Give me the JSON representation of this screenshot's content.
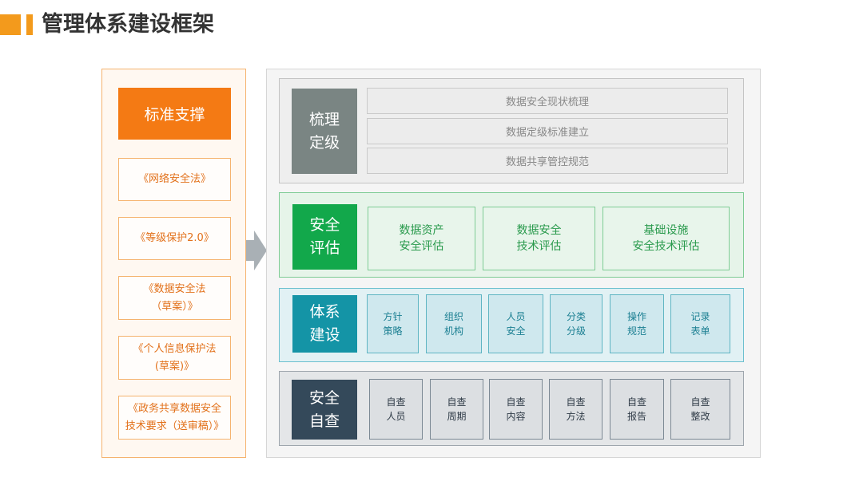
{
  "title": "管理体系建设框架",
  "colors": {
    "accent_orange": "#f47a14",
    "green": "#12a84b",
    "teal": "#1494a6",
    "dark": "#34495a",
    "gray": "#7a8583"
  },
  "standards": {
    "header": "标准支撑",
    "items": [
      "《网络安全法》",
      "《等级保护2.0》",
      "《数据安全法\n（草案）》",
      "《个人信息保护法\n(草案)》",
      "《政务共享数据安全\n技术要求（送审稿）》"
    ]
  },
  "sections": {
    "combing": {
      "label": "梳理\n定级",
      "items": [
        "数据安全现状梳理",
        "数据定级标准建立",
        "数据共享管控规范"
      ]
    },
    "assessment": {
      "label": "安全\n评估",
      "items": [
        "数据资产\n安全评估",
        "数据安全\n技术评估",
        "基础设施\n安全技术评估"
      ]
    },
    "system": {
      "label": "体系\n建设",
      "items": [
        "方针\n策略",
        "组织\n机构",
        "人员\n安全",
        "分类\n分级",
        "操作\n规范",
        "记录\n表单"
      ]
    },
    "selfcheck": {
      "label": "安全\n自查",
      "items": [
        "自查\n人员",
        "自查\n周期",
        "自查\n内容",
        "自查\n方法",
        "自查\n报告",
        "自查\n整改"
      ]
    }
  }
}
